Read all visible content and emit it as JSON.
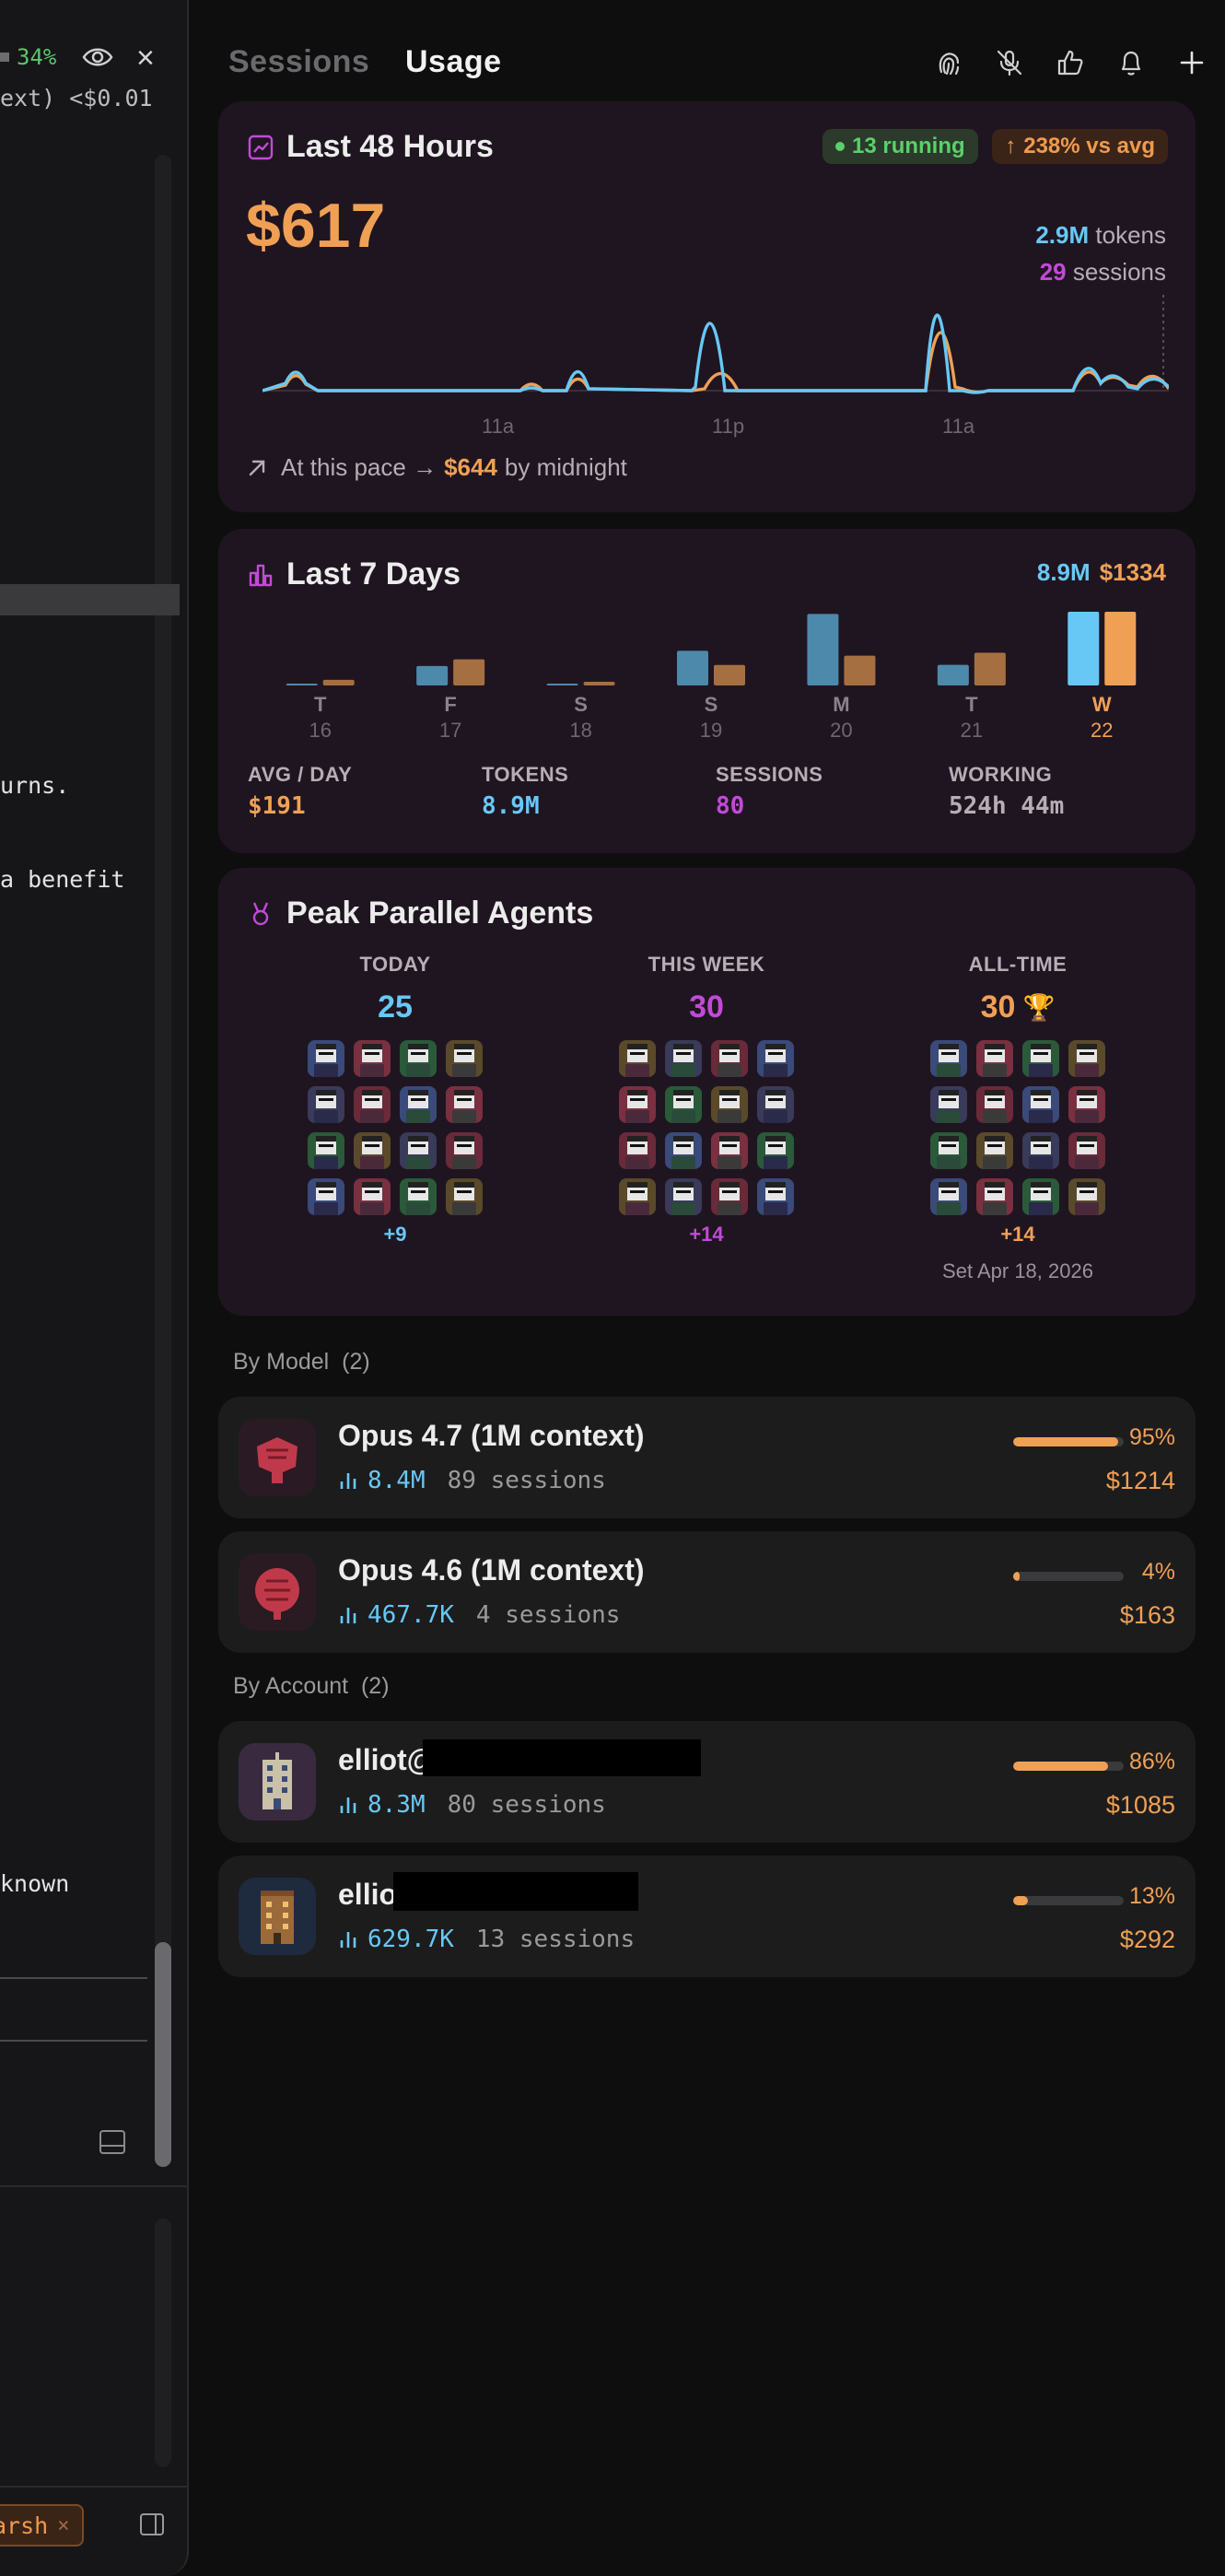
{
  "left_panel": {
    "percent": "34%",
    "cost_line": "ext)  <$0.01",
    "text_lines": [
      "urns.",
      "a benefit",
      "known"
    ],
    "branch_chip": "arsh"
  },
  "header": {
    "tabs": [
      "Sessions",
      "Usage"
    ],
    "active_tab": "Usage"
  },
  "last48": {
    "title": "Last 48 Hours",
    "running_badge": "13 running",
    "vs_avg_badge": "238% vs avg",
    "cost": "$617",
    "tokens_value": "2.9M",
    "tokens_label": "tokens",
    "sessions_value": "29",
    "sessions_label": "sessions",
    "x_labels": [
      "11a",
      "11p",
      "11a"
    ],
    "pace_prefix": "At this pace →",
    "pace_value": "$644",
    "pace_suffix": "by midnight"
  },
  "last7": {
    "title": "Last 7 Days",
    "total_tokens": "8.9M",
    "total_cost": "$1334",
    "stats": [
      {
        "label": "AVG / DAY",
        "value": "$191",
        "color": "#f0a055"
      },
      {
        "label": "TOKENS",
        "value": "8.9M",
        "color": "#67c8f6"
      },
      {
        "label": "SESSIONS",
        "value": "80",
        "color": "#c24ad8"
      },
      {
        "label": "WORKING",
        "value": "524h 44m",
        "color": "#b5aeb5"
      }
    ]
  },
  "chart_data": {
    "type": "bar",
    "categories": [
      "T 16",
      "F 17",
      "S 18",
      "S 19",
      "M 20",
      "T 21",
      "W 22"
    ],
    "day_letters": [
      "T",
      "F",
      "S",
      "S",
      "M",
      "T",
      "W"
    ],
    "day_numbers": [
      "16",
      "17",
      "18",
      "19",
      "20",
      "21",
      "22"
    ],
    "series": [
      {
        "values": [
          0.02,
          0.9,
          0.04,
          1.6,
          3.3,
          0.95,
          3.4
        ],
        "color": "#67c8f6"
      },
      {
        "values": [
          30,
          140,
          20,
          110,
          160,
          175,
          395
        ],
        "color": "#f0a055"
      }
    ],
    "highlight_index": 6,
    "ylim_tokens": [
      0,
      3.4
    ],
    "ylim_cost": [
      0,
      395
    ]
  },
  "peak": {
    "title": "Peak Parallel Agents",
    "columns": [
      {
        "label": "TODAY",
        "value": "25",
        "more": "+9",
        "color": "#67c8f6",
        "date": "",
        "trophy": false
      },
      {
        "label": "THIS WEEK",
        "value": "30",
        "more": "+14",
        "color": "#c24ad8",
        "date": "",
        "trophy": true
      },
      {
        "label": "ALL-TIME",
        "value": "30",
        "more": "+14",
        "color": "#f0a055",
        "date": "Set Apr 18, 2026",
        "trophy": true
      }
    ]
  },
  "by_model": {
    "label": "By Model",
    "count": "(2)",
    "items": [
      {
        "name": "Opus 4.7 (1M context)",
        "tokens": "8.4M",
        "sessions": "89 sessions",
        "percent": "95%",
        "fill": 0.95,
        "cost": "$1214"
      },
      {
        "name": "Opus 4.6 (1M context)",
        "tokens": "467.7K",
        "sessions": "4 sessions",
        "percent": "4%",
        "fill": 0.04,
        "cost": "$163"
      }
    ]
  },
  "by_account": {
    "label": "By Account",
    "count": "(2)",
    "items": [
      {
        "name": "elliot@",
        "tokens": "8.3M",
        "sessions": "80 sessions",
        "percent": "86%",
        "fill": 0.86,
        "cost": "$1085"
      },
      {
        "name": "ellio",
        "tokens": "629.7K",
        "sessions": "13 sessions",
        "percent": "13%",
        "fill": 0.13,
        "cost": "$292"
      }
    ]
  },
  "colors": {
    "tokens": "#67c8f6",
    "cost": "#f0a055",
    "sessions": "#c24ad8",
    "running": "#5ad06a"
  }
}
